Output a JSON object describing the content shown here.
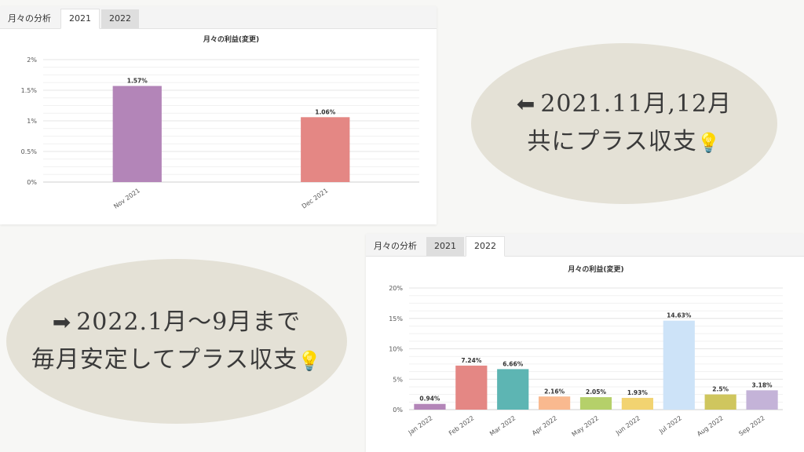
{
  "top_panel": {
    "tabs": [
      {
        "label": "月々の分析",
        "state": "label"
      },
      {
        "label": "2021",
        "state": "active"
      },
      {
        "label": "2022",
        "state": "inactive"
      }
    ]
  },
  "bottom_panel": {
    "tabs": [
      {
        "label": "月々の分析",
        "state": "label"
      },
      {
        "label": "2021",
        "state": "inactive"
      },
      {
        "label": "2022",
        "state": "active"
      }
    ]
  },
  "callout_top": {
    "arrow": "⬅",
    "line1": "2021.11月,12月",
    "line2": "共にプラス収支",
    "icon": "lightbulb-icon"
  },
  "callout_bottom": {
    "arrow": "➡",
    "line1": "2022.1月〜9月まで",
    "line2": "毎月安定してプラス収支",
    "icon": "lightbulb-icon"
  },
  "chart_data": [
    {
      "type": "bar",
      "title": "月々の利益(変更)",
      "categories": [
        "Nov 2021",
        "Dec 2021"
      ],
      "values": [
        1.57,
        1.06
      ],
      "value_labels": [
        "1.57%",
        "1.06%"
      ],
      "colors": [
        "#b385b8",
        "#e48784"
      ],
      "ylim": [
        0,
        2
      ],
      "yticks": [
        0,
        0.5,
        1,
        1.5,
        2
      ],
      "ytick_labels": [
        "0%",
        "0.5%",
        "1%",
        "1.5%",
        "2%"
      ],
      "grid": true
    },
    {
      "type": "bar",
      "title": "月々の利益(変更)",
      "categories": [
        "Jan 2022",
        "Feb 2022",
        "Mar 2022",
        "Apr 2022",
        "May 2022",
        "Jun 2022",
        "Jul 2022",
        "Aug 2022",
        "Sep 2022"
      ],
      "values": [
        0.94,
        7.24,
        6.66,
        2.16,
        2.05,
        1.93,
        14.63,
        2.5,
        3.18
      ],
      "value_labels": [
        "0.94%",
        "7.24%",
        "6.66%",
        "2.16%",
        "2.05%",
        "1.93%",
        "14.63%",
        "2.5%",
        "3.18%"
      ],
      "colors": [
        "#b385b8",
        "#e48784",
        "#5db5b3",
        "#f9b98f",
        "#b5d06a",
        "#f2d371",
        "#cde3f8",
        "#cfc65e",
        "#c4b3d8"
      ],
      "ylim": [
        0,
        20
      ],
      "yticks": [
        0,
        5,
        10,
        15,
        20
      ],
      "ytick_labels": [
        "0%",
        "5%",
        "10%",
        "15%",
        "20%"
      ],
      "grid": true
    }
  ]
}
